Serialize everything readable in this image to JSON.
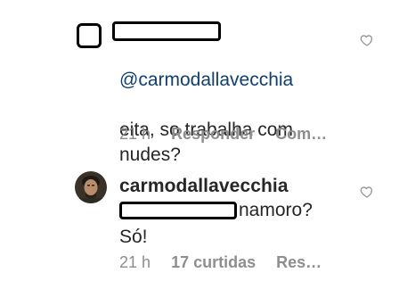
{
  "comments": [
    {
      "mention": "@carmodallavecchia",
      "text": "eita, so trabalha com\nnudes?",
      "time": "21 h",
      "reply_label": "Responder",
      "more_label": "Com…",
      "avatar_icon": "redacted-avatar"
    },
    {
      "username": "carmodallavecchia",
      "text_after_redaction": "namoro?",
      "text_line2": "Só!",
      "time": "21 h",
      "likes_label": "17 curtidas",
      "more_label": "Res…",
      "avatar_icon": "profile-photo"
    }
  ],
  "icons": {
    "like": "heart-outline-icon"
  },
  "colors": {
    "mention": "#0f3f73",
    "meta": "#8e8e8e",
    "text": "#262626"
  }
}
